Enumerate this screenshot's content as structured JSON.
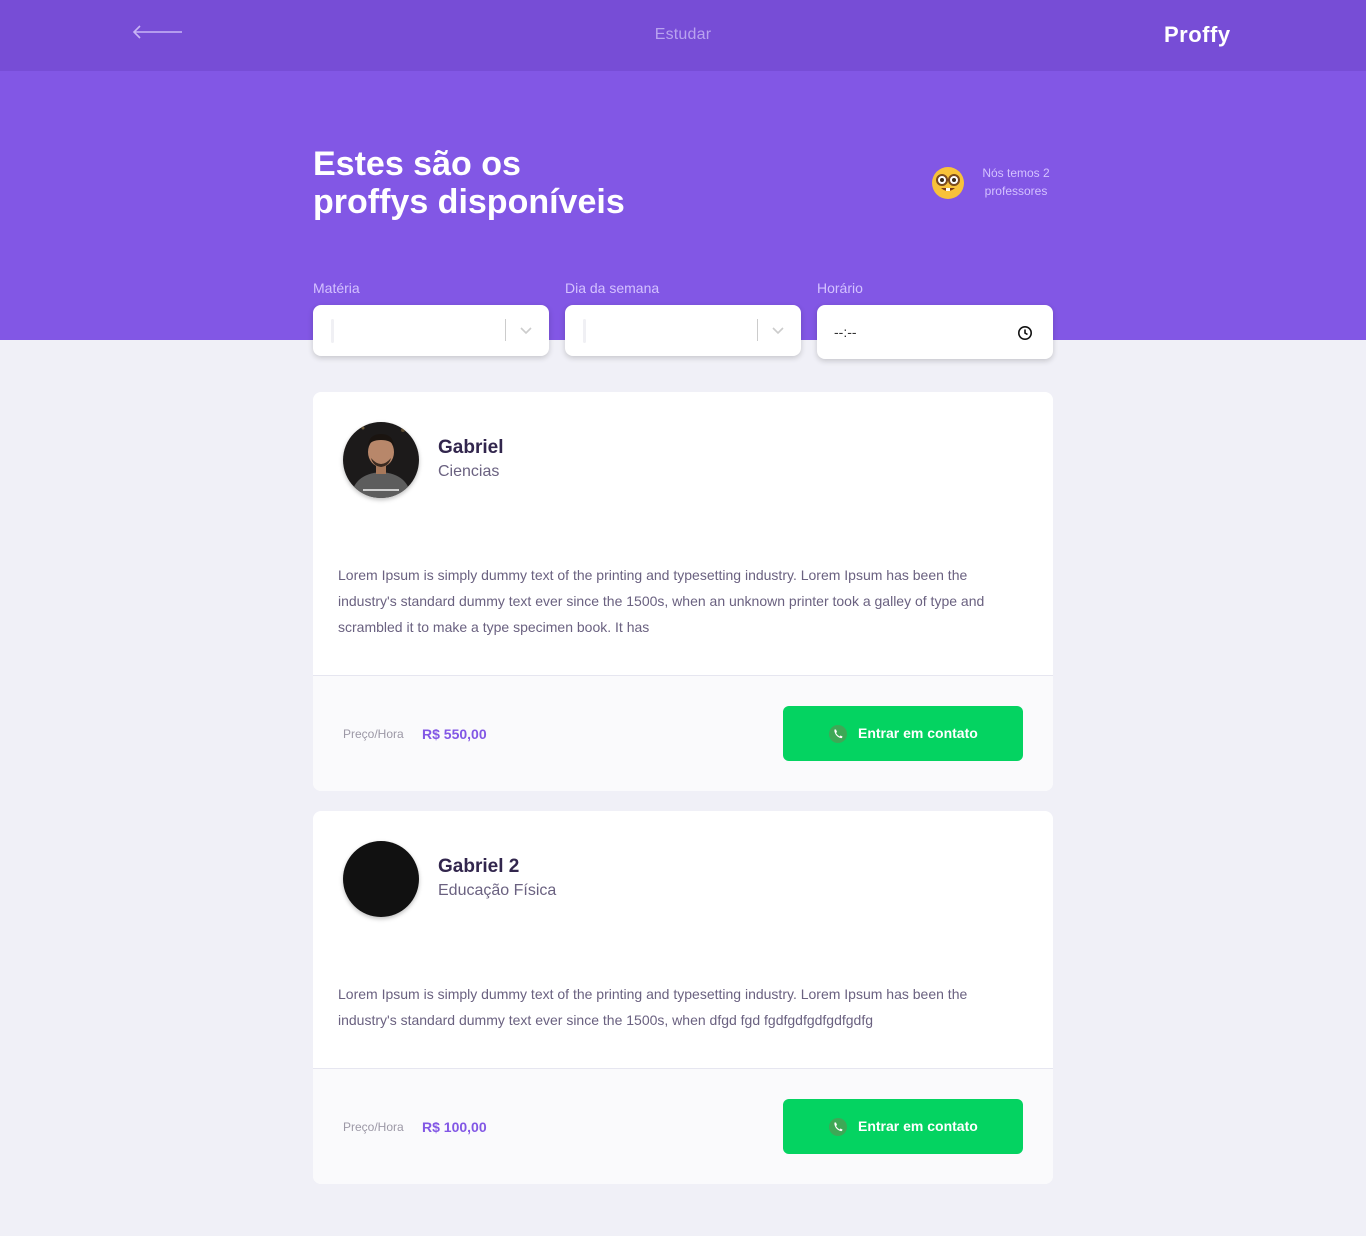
{
  "header": {
    "title": "Estudar",
    "logo": "Proffy",
    "back_icon": "arrow-left-icon"
  },
  "hero": {
    "title_line1": "Estes são os",
    "title_line2": "proffys disponíveis",
    "teacher_count_line1": "Nós temos 2",
    "teacher_count_line2": "professores",
    "emoji_icon": "nerd-face-emoji-icon"
  },
  "filters": {
    "subject_label": "Matéria",
    "subject_value": "",
    "weekday_label": "Dia da semana",
    "weekday_value": "",
    "time_label": "Horário",
    "time_value": "--:--",
    "chevron_icon": "chevron-down-icon",
    "clock_icon": "clock-icon"
  },
  "teachers": [
    {
      "name": "Gabriel",
      "subject": "Ciencias",
      "bio": "Lorem Ipsum is simply dummy text of the printing and typesetting industry. Lorem Ipsum has been the industry's standard dummy text ever since the 1500s, when an unknown printer took a galley of type and scrambled it to make a type specimen book. It has",
      "price_label": "Preço/Hora",
      "price_value": "R$ 550,00",
      "button_label": "Entrar em contato"
    },
    {
      "name": "Gabriel 2",
      "subject": "Educação Física",
      "bio": "Lorem Ipsum is simply dummy text of the printing and typesetting industry. Lorem Ipsum has been the industry's standard dummy text ever since the 1500s, when dfgd fgd fgdfgdfgdfgdfgdfg",
      "price_label": "Preço/Hora",
      "price_value": "R$ 100,00",
      "button_label": "Entrar em contato"
    }
  ],
  "colors": {
    "primary": "#8257e5",
    "primary_dark": "#774dd6",
    "accent_green": "#04d361",
    "background": "#f0f0f7"
  }
}
